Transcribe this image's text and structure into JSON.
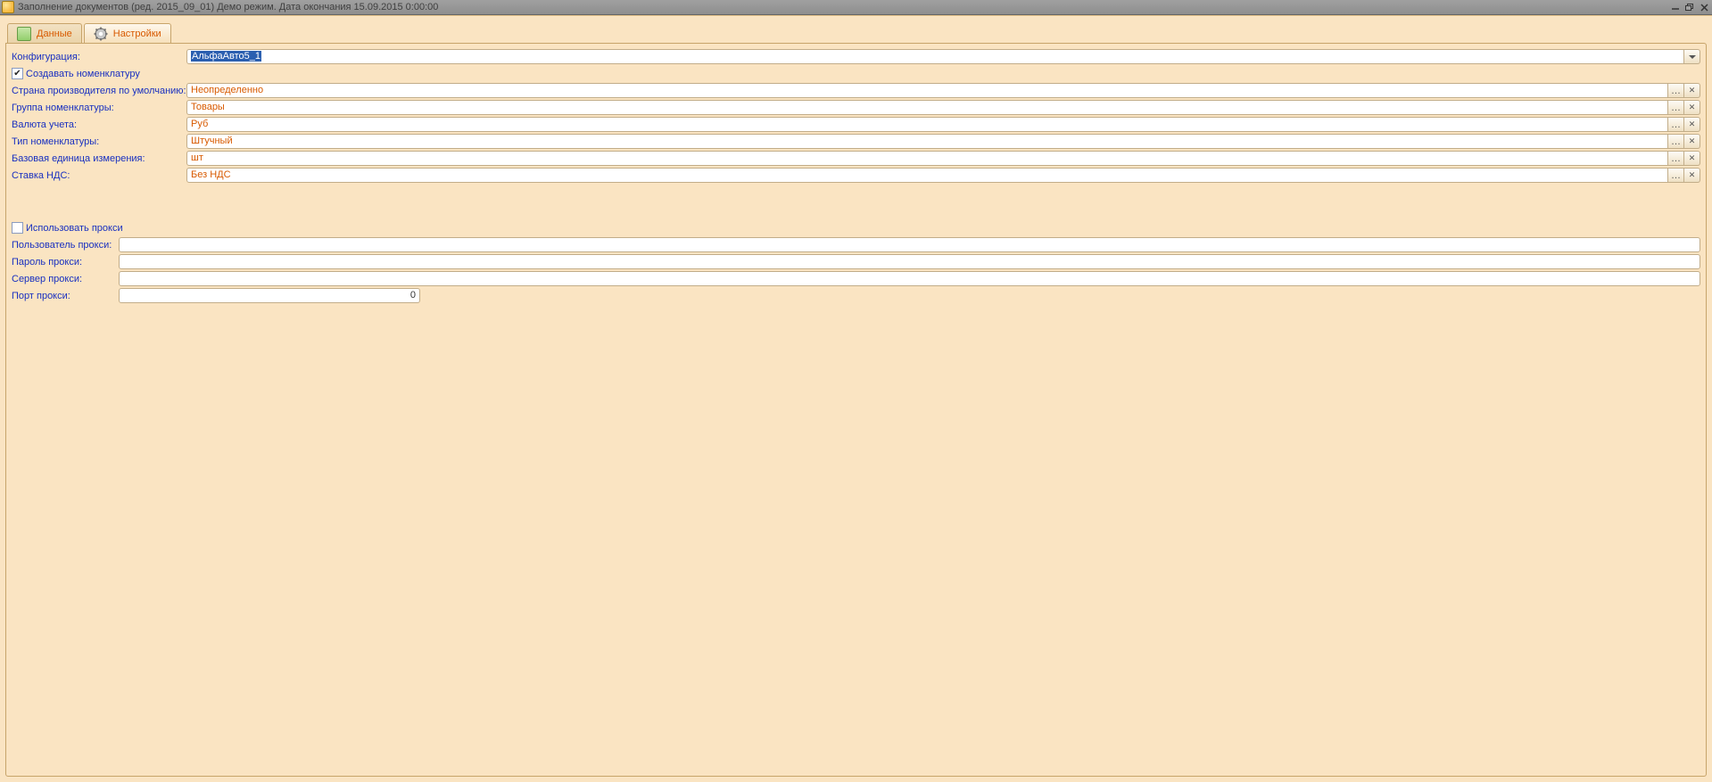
{
  "window": {
    "title": "Заполнение документов (ред. 2015_09_01) Демо режим. Дата окончания 15.09.2015 0:00:00"
  },
  "tabs": {
    "data": "Данные",
    "settings": "Настройки"
  },
  "form": {
    "config_label": "Конфигурация:",
    "config_value": "АльфаАвто5_1",
    "create_nomen": "Создавать номенклатуру",
    "country_label": "Страна производителя по умолчанию:",
    "country_value": "Неопределенно",
    "group_label": "Группа номенклатуры:",
    "group_value": "Товары",
    "currency_label": "Валюта учета:",
    "currency_value": "Руб",
    "type_label": "Тип номенклатуры:",
    "type_value": "Штучный",
    "unit_label": "Базовая единица измерения:",
    "unit_value": "шт",
    "vat_label": "Ставка НДС:",
    "vat_value": "Без НДС"
  },
  "proxy": {
    "use_proxy": "Использовать прокси",
    "user_label": "Пользователь прокси:",
    "user_value": "",
    "pass_label": "Пароль прокси:",
    "pass_value": "",
    "server_label": "Сервер прокси:",
    "server_value": "",
    "port_label": "Порт прокси:",
    "port_value": "0"
  }
}
